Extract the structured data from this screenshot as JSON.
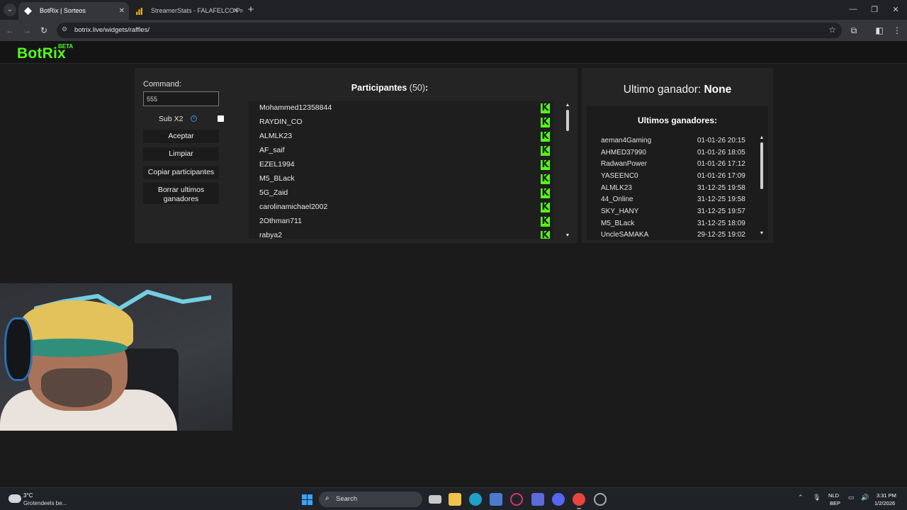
{
  "browser": {
    "tabs": [
      {
        "title": "BotRix | Sorteos",
        "active": true
      },
      {
        "title": "StreamerStats - FALAFELCO Pro",
        "active": false
      }
    ],
    "url": "botrix.live/widgets/raffles/"
  },
  "app": {
    "logo": "BotRix",
    "logo_badge": "BETA",
    "accent_color": "#53fc18"
  },
  "controls": {
    "command_label": "Command:",
    "command_value": "555",
    "sub_x2_label": "Sub X2",
    "sub_x2_checked": false,
    "buttons": {
      "accept": "Aceptar",
      "clear": "Limpiar",
      "copy": "Copiar participantes",
      "delete_last": "Borrar ultimos ganadores"
    }
  },
  "participants": {
    "title": "Participantes",
    "count": "(50)",
    "title_suffix": ":",
    "items": [
      "Mohammed12358844",
      "RAYDIN_CO",
      "ALMLK23",
      "AF_saif",
      "EZEL1994",
      "M5_BLack",
      "5G_Zaid",
      "carolinamichael2002",
      "2Othman711",
      "rabya2"
    ]
  },
  "winner": {
    "label": "Ultimo ganador:",
    "value": "None",
    "list_title": "Ultimos ganadores:",
    "items": [
      {
        "name": "aeman4Gaming",
        "date": "01-01-26 20:15"
      },
      {
        "name": "AHMED37990",
        "date": "01-01-26 18:05"
      },
      {
        "name": "RadwanPower",
        "date": "01-01-26 17:12"
      },
      {
        "name": "YASEENC0",
        "date": "01-01-26 17:09"
      },
      {
        "name": "ALMLK23",
        "date": "31-12-25 19:58"
      },
      {
        "name": "44_Online",
        "date": "31-12-25 19:58"
      },
      {
        "name": "SKY_HANY",
        "date": "31-12-25 19:57"
      },
      {
        "name": "M5_BLack",
        "date": "31-12-25 18:09"
      },
      {
        "name": "UncleSAMAKA",
        "date": "29-12-25 19:02"
      }
    ]
  },
  "taskbar": {
    "weather_temp": "3°C",
    "weather_desc": "Grotendeels be...",
    "search_placeholder": "Search",
    "lang_top": "NLD",
    "lang_bottom": "BEP",
    "time": "3:31 PM",
    "date": "1/2/2026"
  }
}
